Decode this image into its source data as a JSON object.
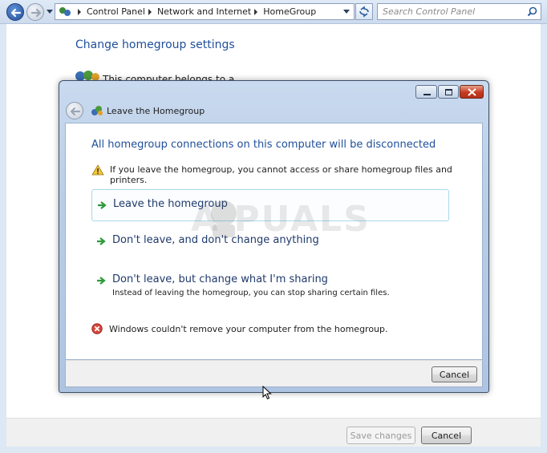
{
  "explorer": {
    "breadcrumbs": [
      "Control Panel",
      "Network and Internet",
      "HomeGroup"
    ],
    "search_placeholder": "Search Control Panel",
    "page_title": "Change homegroup settings",
    "partial_text": "This computer belongs to a",
    "save_label": "Save changes",
    "cancel_label": "Cancel"
  },
  "dialog": {
    "title": "Leave the Homegroup",
    "heading": "All homegroup connections on this computer will be disconnected",
    "warning": "If you leave the homegroup, you cannot access or share homegroup files and printers.",
    "options": [
      {
        "label": "Leave the homegroup",
        "description": ""
      },
      {
        "label": "Don't leave, and don't change anything",
        "description": ""
      },
      {
        "label": "Don't leave, but change what I'm sharing",
        "description": "Instead of leaving the homegroup, you can stop sharing certain files."
      }
    ],
    "error": "Windows couldn't remove your computer from the homegroup.",
    "cancel_label": "Cancel"
  },
  "watermark": "A PUALS",
  "colors": {
    "heading_blue": "#1f4e9b",
    "command_link_blue": "#1f3a6b",
    "close_red": "#c53b20",
    "focus_border": "#a9d9ea"
  },
  "icons": [
    "back-arrow-icon",
    "forward-arrow-icon",
    "homegroup-icon",
    "refresh-icon",
    "search-icon",
    "warning-icon",
    "green-arrow-icon",
    "error-icon",
    "mouse-cursor-icon"
  ]
}
